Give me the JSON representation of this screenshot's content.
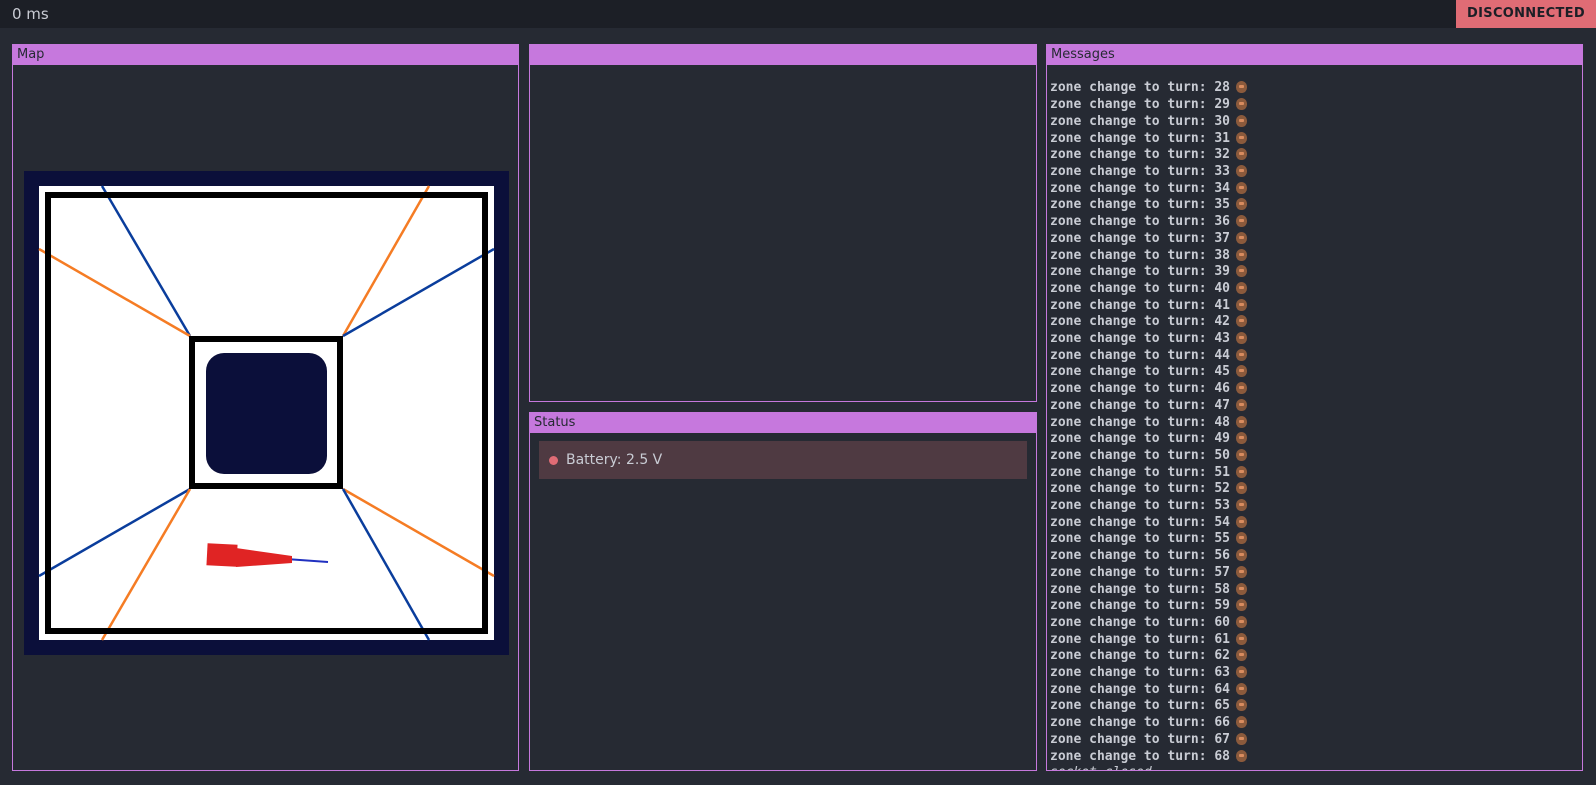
{
  "topbar": {
    "latency": "0 ms",
    "connection_status": "DISCONNECTED"
  },
  "panels": {
    "map": {
      "title": "Map"
    },
    "middle": {
      "title": ""
    },
    "status": {
      "title": "Status",
      "items": [
        {
          "label": "Battery: 2.5 V",
          "state": "error",
          "color": "#e06c75"
        }
      ]
    },
    "messages": {
      "title": "Messages",
      "icon": "emoji-face-icon",
      "lines": [
        "zone change to turn: 28",
        "zone change to turn: 29",
        "zone change to turn: 30",
        "zone change to turn: 31",
        "zone change to turn: 32",
        "zone change to turn: 33",
        "zone change to turn: 34",
        "zone change to turn: 35",
        "zone change to turn: 36",
        "zone change to turn: 37",
        "zone change to turn: 38",
        "zone change to turn: 39",
        "zone change to turn: 40",
        "zone change to turn: 41",
        "zone change to turn: 42",
        "zone change to turn: 43",
        "zone change to turn: 44",
        "zone change to turn: 45",
        "zone change to turn: 46",
        "zone change to turn: 47",
        "zone change to turn: 48",
        "zone change to turn: 49",
        "zone change to turn: 50",
        "zone change to turn: 51",
        "zone change to turn: 52",
        "zone change to turn: 53",
        "zone change to turn: 54",
        "zone change to turn: 55",
        "zone change to turn: 56",
        "zone change to turn: 57",
        "zone change to turn: 58",
        "zone change to turn: 59",
        "zone change to turn: 60",
        "zone change to turn: 61",
        "zone change to turn: 62",
        "zone change to turn: 63",
        "zone change to turn: 64",
        "zone change to turn: 65",
        "zone change to turn: 66",
        "zone change to turn: 67",
        "zone change to turn: 68"
      ],
      "closed_text": "socket closed"
    }
  },
  "colors": {
    "accent": "#c678dd",
    "background": "#262a33",
    "topbar": "#1c1f26",
    "disconnected": "#e06c75",
    "map_border": "#0b0f3a",
    "track_wall": "#000000",
    "zone_line_blue": "#0a3d9c",
    "zone_line_orange": "#f57c24",
    "robot": "#e02424",
    "robot_heading": "#2030c0"
  }
}
